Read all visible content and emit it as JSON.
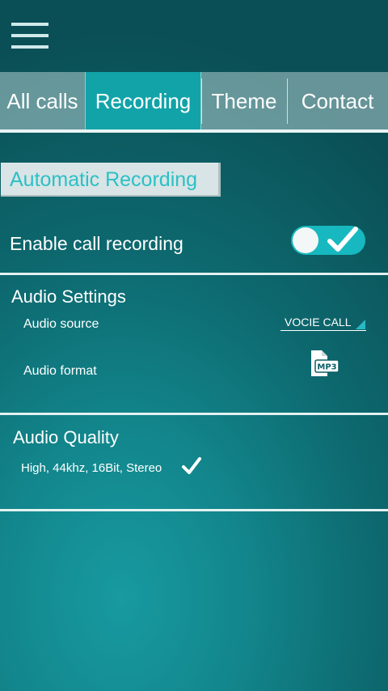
{
  "header": {
    "menu_icon": "hamburger-menu-icon"
  },
  "tabs": [
    {
      "label": "All calls",
      "active": false
    },
    {
      "label": "Recording",
      "active": true
    },
    {
      "label": "Theme",
      "active": false
    },
    {
      "label": "Contact",
      "active": false
    }
  ],
  "automatic_recording": {
    "title": "Automatic Recording"
  },
  "enable_recording": {
    "label": "Enable call recording",
    "enabled": true
  },
  "audio_settings": {
    "title": "Audio Settings",
    "source_label": "Audio source",
    "source_value": "VOCIE CALL",
    "format_label": "Audio format",
    "format_icon": "mp3-file-icon",
    "format_badge": "MP3"
  },
  "audio_quality": {
    "title": "Audio Quality",
    "value": "High, 44khz, 16Bit, Stereo",
    "selected": true
  },
  "colors": {
    "accent": "#12a3a8",
    "chip_text": "#2cc0c6",
    "toggle_on": "#17b8bf",
    "background_dark": "#0a4f55",
    "background_light": "#179aa0"
  }
}
